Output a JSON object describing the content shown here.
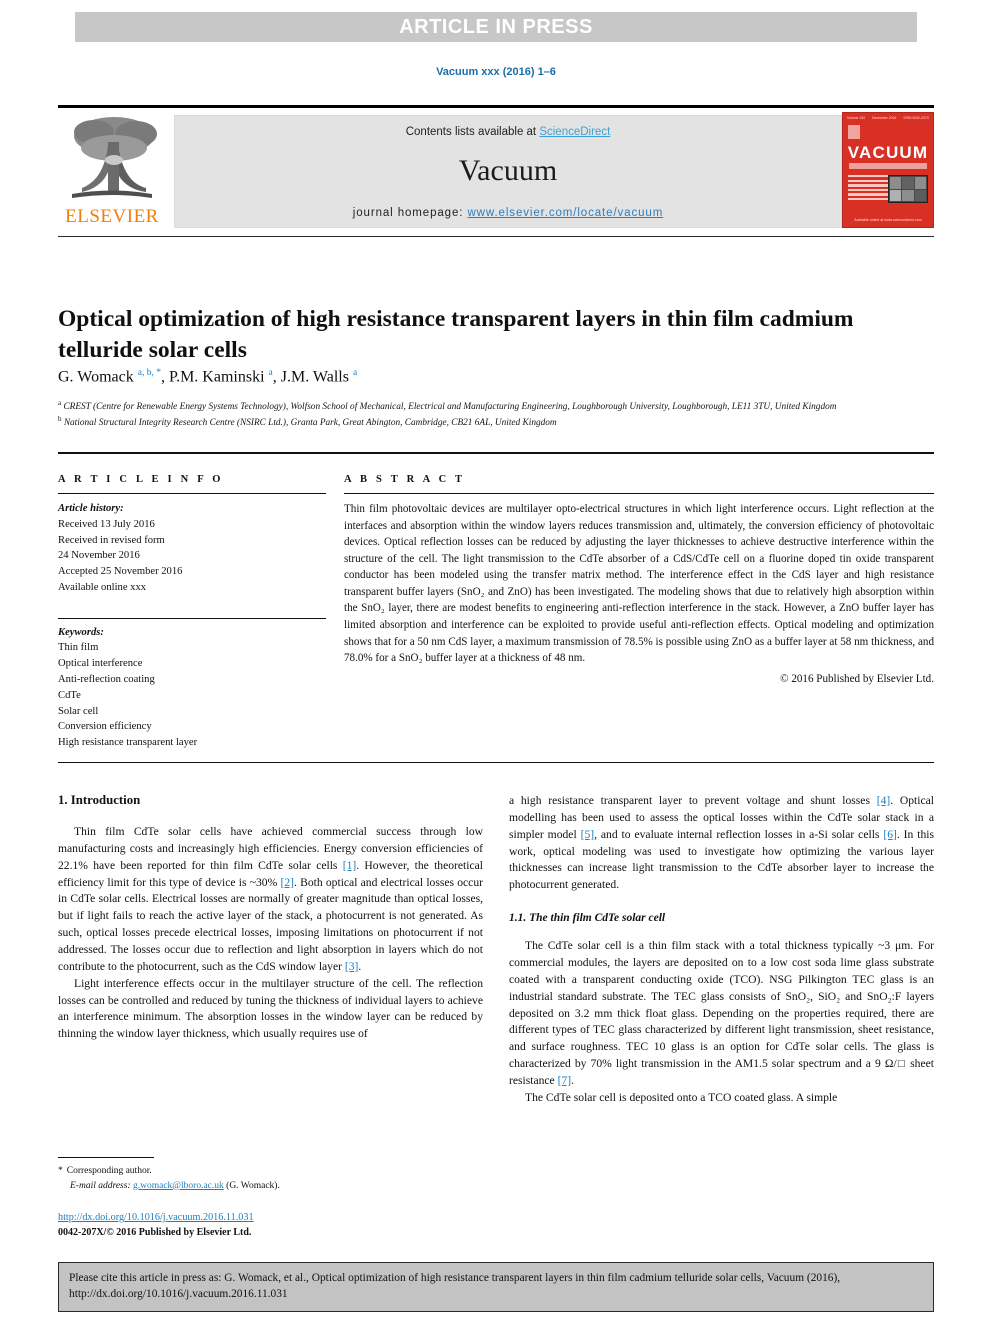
{
  "banner": {
    "text": "ARTICLE IN PRESS"
  },
  "journal_ref": "Vacuum xxx (2016) 1–6",
  "masthead": {
    "publisher": "ELSEVIER",
    "contents_prefix": "Contents lists available at ",
    "contents_link": "ScienceDirect",
    "journal_name": "Vacuum",
    "homepage_prefix": "journal homepage: ",
    "homepage_url": "www.elsevier.com/locate/vacuum",
    "cover": {
      "title": "VACUUM",
      "top_left": "Volume 134",
      "top_mid": "December 2016",
      "top_right": "ISSN 0042-207X",
      "bottom": "Available online at www.sciencedirect.com"
    }
  },
  "article": {
    "title": "Optical optimization of high resistance transparent layers in thin film cadmium telluride solar cells",
    "authors_html": "G. Womack <sup>a, b, *</sup>, P.M. Kaminski <sup>a</sup>, J.M. Walls <sup>a</sup>",
    "affiliations": [
      "CREST (Centre for Renewable Energy Systems Technology), Wolfson School of Mechanical, Electrical and Manufacturing Engineering, Loughborough University, Loughborough, LE11 3TU, United Kingdom",
      "National Structural Integrity Research Centre (NSIRC Ltd.), Granta Park, Great Abington, Cambridge, CB21 6AL, United Kingdom"
    ]
  },
  "info": {
    "heading": "A R T I C L E   I N F O",
    "history_label": "Article history:",
    "history": [
      "Received 13 July 2016",
      "Received in revised form",
      "24 November 2016",
      "Accepted 25 November 2016",
      "Available online xxx"
    ],
    "keywords_label": "Keywords:",
    "keywords": [
      "Thin film",
      "Optical interference",
      "Anti-reflection coating",
      "CdTe",
      "Solar cell",
      "Conversion efficiency",
      "High resistance transparent layer"
    ]
  },
  "abstract": {
    "heading": "A B S T R A C T",
    "text": "Thin film photovoltaic devices are multilayer opto-electrical structures in which light interference occurs. Light reflection at the interfaces and absorption within the window layers reduces transmission and, ultimately, the conversion efficiency of photovoltaic devices. Optical reflection losses can be reduced by adjusting the layer thicknesses to achieve destructive interference within the structure of the cell. The light transmission to the CdTe absorber of a CdS/CdTe cell on a fluorine doped tin oxide transparent conductor has been modeled using the transfer matrix method. The interference effect in the CdS layer and high resistance transparent buffer layers (SnO₂ and ZnO) has been investigated. The modeling shows that due to relatively high absorption within the SnO₂ layer, there are modest benefits to engineering anti-reflection interference in the stack. However, a ZnO buffer layer has limited absorption and interference can be exploited to provide useful anti-reflection effects. Optical modeling and optimization shows that for a 50 nm CdS layer, a maximum transmission of 78.5% is possible using ZnO as a buffer layer at 58 nm thickness, and 78.0% for a SnO₂ buffer layer at a thickness of 48 nm.",
    "copyright": "© 2016 Published by Elsevier Ltd."
  },
  "body": {
    "section1_title": "1.  Introduction",
    "left_p1_a": "Thin film CdTe solar cells have achieved commercial success through low manufacturing costs and increasingly high efficiencies. Energy conversion efficiencies of 22.1% have been reported for thin film CdTe solar cells ",
    "left_p1_r1": "[1]",
    "left_p1_b": ". However, the theoretical efficiency limit for this type of device is ~30% ",
    "left_p1_r2": "[2]",
    "left_p1_c": ". Both optical and electrical losses occur in CdTe solar cells. Electrical losses are normally of greater magnitude than optical losses, but if light fails to reach the active layer of the stack, a photocurrent is not generated. As such, optical losses precede electrical losses, imposing limitations on photocurrent if not addressed. The losses occur due to reflection and light absorption in layers which do not contribute to the photocurrent, such as the CdS window layer ",
    "left_p1_r3": "[3]",
    "left_p1_d": ".",
    "left_p2": "Light interference effects occur in the multilayer structure of the cell. The reflection losses can be controlled and reduced by tuning the thickness of individual layers to achieve an interference minimum. The absorption losses in the window layer can be reduced by thinning the window layer thickness, which usually requires use of",
    "right_p1_a": "a high resistance transparent layer to prevent voltage and shunt losses ",
    "right_p1_r1": "[4]",
    "right_p1_b": ". Optical modelling has been used to assess the optical losses within the CdTe solar stack in a simpler model ",
    "right_p1_r2": "[5]",
    "right_p1_c": ", and to evaluate internal reflection losses in a-Si solar cells ",
    "right_p1_r3": "[6]",
    "right_p1_d": ". In this work, optical modeling was used to investigate how optimizing the various layer thicknesses can increase light transmission to the CdTe absorber layer to increase the photocurrent generated.",
    "subsection_title": "1.1.  The thin film CdTe solar cell",
    "right_p2_a": "The CdTe solar cell is a thin film stack with a total thickness typically ~3 μm. For commercial modules, the layers are deposited on to a low cost soda lime glass substrate coated with a transparent conducting oxide (TCO). NSG Pilkington TEC glass is an industrial standard substrate. The TEC glass consists of SnO₂, SiO₂ and SnO₂:F layers deposited on 3.2 mm thick float glass. Depending on the properties required, there are different types of TEC glass characterized by different light transmission, sheet resistance, and surface roughness. TEC 10 glass is an option for CdTe solar cells. The glass is characterized by 70% light transmission in the AM1.5 solar spectrum and a 9 Ω/□ sheet resistance ",
    "right_p2_r1": "[7]",
    "right_p2_b": ".",
    "right_p3": "The CdTe solar cell is deposited onto a TCO coated glass. A simple"
  },
  "footnote": {
    "corresponding": "Corresponding author.",
    "email_label": "E-mail address:",
    "email": "g.womack@lboro.ac.uk",
    "email_owner": "(G. Womack)."
  },
  "doi": {
    "link": "http://dx.doi.org/10.1016/j.vacuum.2016.11.031",
    "issn": "0042-207X/© 2016 Published by Elsevier Ltd."
  },
  "cite": {
    "text": "Please cite this article in press as: G. Womack, et al., Optical optimization of high resistance transparent layers in thin film cadmium telluride solar cells, Vacuum (2016), http://dx.doi.org/10.1016/j.vacuum.2016.11.031"
  },
  "colors": {
    "banner_bg": "#c7c7c7",
    "link_blue": "#1b7fbf",
    "elsevier_orange": "#f07f09",
    "cover_red": "#d93025",
    "masthead_gray": "#e3e3e3",
    "cite_box_bg": "#c3c3c3"
  }
}
